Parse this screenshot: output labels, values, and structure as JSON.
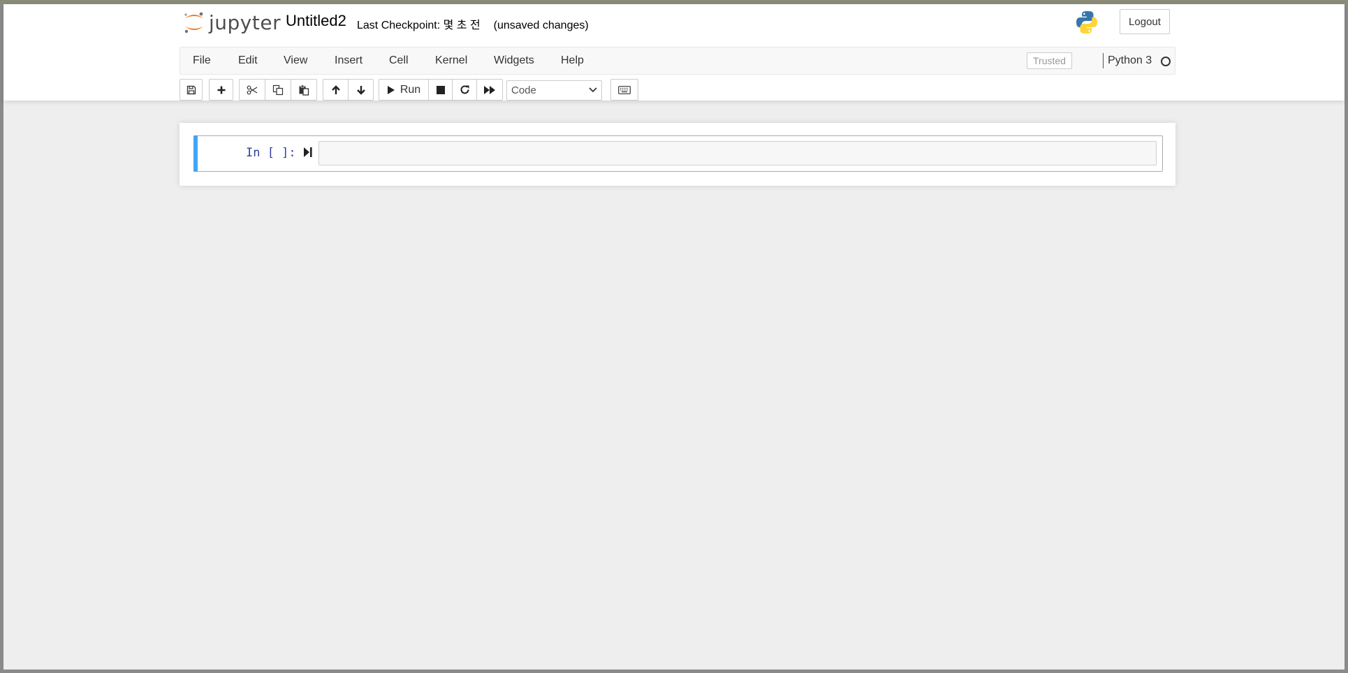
{
  "app": {
    "logo_text": "jupyter",
    "notebook_title": "Untitled2",
    "checkpoint_label": "Last Checkpoint:",
    "checkpoint_time": "몇 초 전",
    "save_status": "(unsaved changes)",
    "logout_label": "Logout"
  },
  "menubar": {
    "items": [
      {
        "label": "File"
      },
      {
        "label": "Edit"
      },
      {
        "label": "View"
      },
      {
        "label": "Insert"
      },
      {
        "label": "Cell"
      },
      {
        "label": "Kernel"
      },
      {
        "label": "Widgets"
      },
      {
        "label": "Help"
      }
    ],
    "trusted_label": "Trusted",
    "kernel_name": "Python 3"
  },
  "toolbar": {
    "run_label": "Run",
    "cell_type": "Code",
    "icons": [
      "save-icon",
      "plus-icon",
      "cut-icon",
      "copy-icon",
      "paste-icon",
      "arrow-up-icon",
      "arrow-down-icon",
      "play-icon",
      "stop-icon",
      "restart-icon",
      "fast-forward-icon",
      "keyboard-icon"
    ]
  },
  "cell": {
    "prompt": "In [ ]:",
    "content": ""
  },
  "colors": {
    "logo_orange": "#f37726",
    "selected_cell_bar": "#42a5f5",
    "prompt_blue": "#303f9f",
    "background": "#eeeeee"
  }
}
